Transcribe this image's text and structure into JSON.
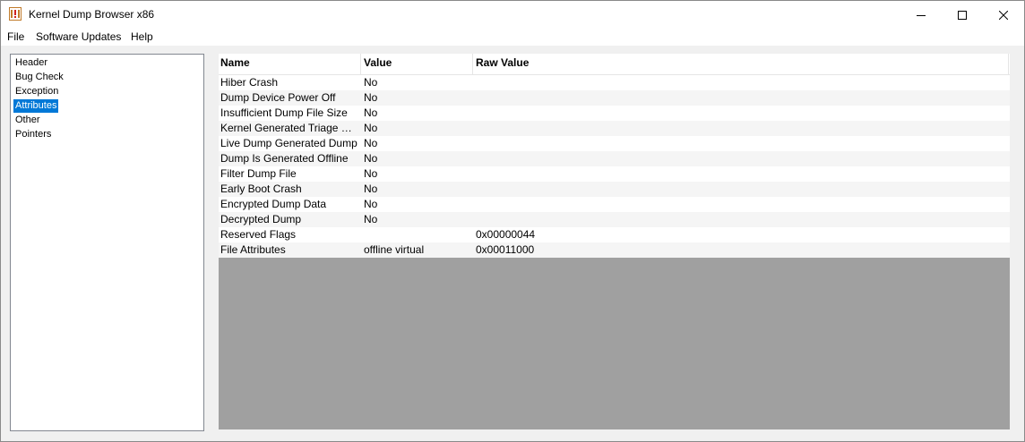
{
  "window": {
    "title": "Kernel Dump Browser x86",
    "app_icon": "dump-document-icon",
    "controls": {
      "minimize_icon": "minimize-icon",
      "maximize_icon": "maximize-icon",
      "close_icon": "close-icon"
    }
  },
  "menubar": {
    "items": [
      "File",
      "Software Updates",
      "Help"
    ]
  },
  "sidebar": {
    "items": [
      {
        "label": "Header",
        "selected": false
      },
      {
        "label": "Bug Check",
        "selected": false
      },
      {
        "label": "Exception",
        "selected": false
      },
      {
        "label": "Attributes",
        "selected": true
      },
      {
        "label": "Other",
        "selected": false
      },
      {
        "label": "Pointers",
        "selected": false
      }
    ],
    "selection_color": "#0078d7"
  },
  "table": {
    "columns": [
      "Name",
      "Value",
      "Raw Value"
    ],
    "rows": [
      {
        "name": "Hiber Crash",
        "value": "No",
        "raw": ""
      },
      {
        "name": "Dump Device Power Off",
        "value": "No",
        "raw": ""
      },
      {
        "name": "Insufficient Dump File Size",
        "value": "No",
        "raw": ""
      },
      {
        "name": "Kernel Generated Triage Du...",
        "value": "No",
        "raw": ""
      },
      {
        "name": "Live Dump Generated Dump",
        "value": "No",
        "raw": ""
      },
      {
        "name": "Dump Is Generated Offline",
        "value": "No",
        "raw": ""
      },
      {
        "name": "Filter Dump File",
        "value": "No",
        "raw": ""
      },
      {
        "name": "Early Boot Crash",
        "value": "No",
        "raw": ""
      },
      {
        "name": "Encrypted Dump Data",
        "value": "No",
        "raw": ""
      },
      {
        "name": "Decrypted Dump",
        "value": "No",
        "raw": ""
      },
      {
        "name": "Reserved Flags",
        "value": "",
        "raw": "0x00000044"
      },
      {
        "name": "File Attributes",
        "value": "offline virtual",
        "raw": "0x00011000"
      }
    ],
    "empty_area_color": "#a0a0a0"
  }
}
